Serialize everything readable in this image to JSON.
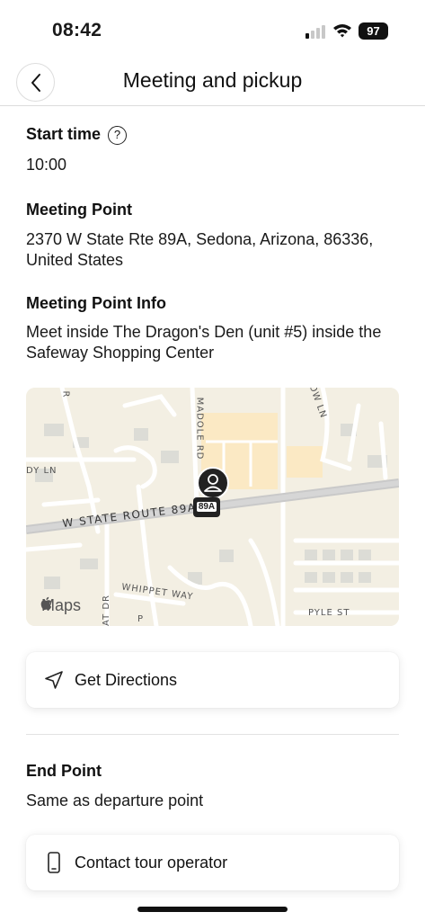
{
  "status_bar": {
    "time": "08:42",
    "battery": "97"
  },
  "header": {
    "title": "Meeting and pickup"
  },
  "start_time": {
    "title": "Start time",
    "help": "?",
    "value": "10:00"
  },
  "meeting_point": {
    "title": "Meeting Point",
    "address": "2370 W State Rte 89A, Sedona, Arizona, 86336, United States"
  },
  "meeting_info": {
    "title": "Meeting Point Info",
    "text": "Meet inside The Dragon's Den (unit #5) inside the Safeway Shopping Center"
  },
  "map": {
    "brand": "Maps",
    "route_label": "W STATE ROUTE 89A",
    "route_shield": "89A",
    "street_labels": {
      "madole": "MADOLE RD",
      "whippet": "WHIPPET WAY",
      "pyle": "PYLE ST",
      "dy_ln": "DY LN",
      "ow_ln": "OW LN",
      "r": "R",
      "at_dr": "AT DR",
      "p": "P"
    }
  },
  "directions_button": {
    "label": "Get Directions",
    "icon": "navigation-arrow-icon"
  },
  "end_point": {
    "title": "End Point",
    "text": "Same as departure point"
  },
  "contact_button": {
    "label": "Contact tour operator",
    "icon": "phone-icon"
  }
}
